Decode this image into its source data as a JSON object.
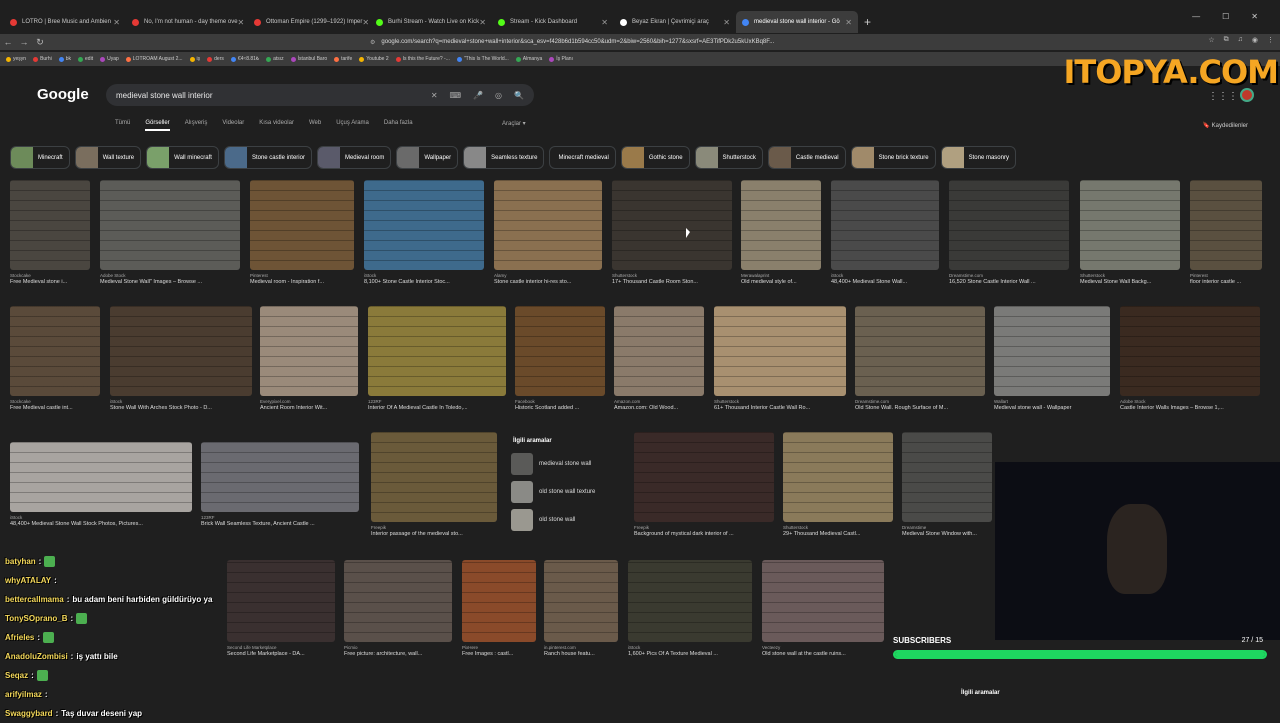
{
  "tabs": [
    {
      "label": "LOTRO | Bree Music and Ambien",
      "color": "#e53935"
    },
    {
      "label": "No, I'm not human - day theme ove",
      "color": "#e53935"
    },
    {
      "label": "Ottoman Empire (1299–1922) Imper",
      "color": "#e53935"
    },
    {
      "label": "Burhi Stream - Watch Live on Kick",
      "color": "#53fc18"
    },
    {
      "label": "Stream - Kick Dashboard",
      "color": "#53fc18"
    },
    {
      "label": "Beyaz Ekran | Çevrimiçi araç",
      "color": "#ffffff"
    },
    {
      "label": "medieval stone wall interior - Gö",
      "color": "#4285f4",
      "active": true
    }
  ],
  "url": "google.com/search?q=medieval+stone+wall+interior&sca_esv=f428b6d1b594cc50&udm=2&biw=2560&bih=1277&sxsrf=AE3TifPDk2u5kUxKBq8F...",
  "bookmarks": [
    "yeşyn",
    "Burhi",
    "bk",
    "edit",
    "Uyap",
    "LOTROAM August 2...",
    "iş",
    "ders",
    "€4≈8.81₺",
    "atsız",
    "İstanbul Baro",
    "tarife",
    "Youtube 2",
    "Is this the Future? -...",
    "\"This Is The World...",
    "Almanya",
    "İş Planı"
  ],
  "watermark": "ITOPYA.COM",
  "google_logo": "Google",
  "search_query": "medieval stone wall interior",
  "menu_tabs": [
    "Tümü",
    "Görseller",
    "Alışveriş",
    "Videolar",
    "Kısa videolar",
    "Web",
    "Uçuş Arama",
    "Daha fazla"
  ],
  "active_menu": "Görseller",
  "tools_label": "Araçlar",
  "saved_label": "Kaydedilenler",
  "chips": [
    {
      "label": "Minecraft",
      "color": "#6d8b5a"
    },
    {
      "label": "Wall texture",
      "color": "#7a6e5e"
    },
    {
      "label": "Wall minecraft",
      "color": "#7aa06a"
    },
    {
      "label": "Stone castle interior",
      "color": "#4b6a8a"
    },
    {
      "label": "Medieval room",
      "color": "#5a5a6a"
    },
    {
      "label": "Wallpaper",
      "color": "#6a6a6a"
    },
    {
      "label": "Seamless texture",
      "color": "#888"
    },
    {
      "label": "Minecraft medieval",
      "color": null
    },
    {
      "label": "Gothic stone",
      "color": "#9a7a4a"
    },
    {
      "label": "Shutterstock",
      "color": "#8a8a7a"
    },
    {
      "label": "Castle medieval",
      "color": "#6a5a4a"
    },
    {
      "label": "Stone brick texture",
      "color": "#a08a6a"
    },
    {
      "label": "Stone masonry",
      "color": "#b0a080"
    }
  ],
  "images": [
    {
      "src": "Stockcake",
      "cap": "Free Medieval stone i...",
      "color": "#4a4640"
    },
    {
      "src": "Adobe Stock",
      "cap": "Medieval Stone Wall\" Images – Browse ...",
      "color": "#5c5c58"
    },
    {
      "src": "Pinterest",
      "cap": "Medieval room - Inspiration f...",
      "color": "#6e5436"
    },
    {
      "src": "iStock",
      "cap": "8,100+ Stone Castle Interior Stoc...",
      "color": "#3e6a8c"
    },
    {
      "src": "Alamy",
      "cap": "Stone castle interior hi-res sto...",
      "color": "#8a7050"
    },
    {
      "src": "Shutterstock",
      "cap": "17+ Thousand Castle Room Ston...",
      "color": "#3a3530"
    },
    {
      "src": "Merawalaprint",
      "cap": "Old medieval style of...",
      "color": "#8a806c"
    },
    {
      "src": "iStock",
      "cap": "48,400+ Medieval Stone Wall...",
      "color": "#4a4a4a"
    },
    {
      "src": "Dreamstime.com",
      "cap": "16,520 Stone Castle Interior Wall ...",
      "color": "#3a3a38"
    },
    {
      "src": "Shutterstock",
      "cap": "Medieval Stone Wall Backg...",
      "color": "#76786e"
    },
    {
      "src": "Pinterest",
      "cap": "floor interior castle ...",
      "color": "#5a5040"
    },
    {
      "src": "Stockcake",
      "cap": "Free Medieval castle int...",
      "color": "#5a4a3a"
    },
    {
      "src": "iStock",
      "cap": "Stone Wall With Arches Stock Photo - D...",
      "color": "#4a3c30"
    },
    {
      "src": "Everypixel.com",
      "cap": "Ancient Room Interior Wit...",
      "color": "#9a8a7a"
    },
    {
      "src": "123RF",
      "cap": "Interior Of A Medieval Castle In Toledo,...",
      "color": "#8a7a3a"
    },
    {
      "src": "Facebook",
      "cap": "Historic Scotland added ...",
      "color": "#6a4a2a"
    },
    {
      "src": "Amazon.com",
      "cap": "Amazon.com: Old Wood...",
      "color": "#8a7a6a"
    },
    {
      "src": "Shutterstock",
      "cap": "61+ Thousand Interior Castle Wall Ro...",
      "color": "#a89070"
    },
    {
      "src": "Dreamstime.com",
      "cap": "Old Stone Wall. Rough Surface of M...",
      "color": "#6a6050"
    },
    {
      "src": "Wallart",
      "cap": "Medieval stone wall - Wallpaper",
      "color": "#7a7a78"
    },
    {
      "src": "Adobe Stock",
      "cap": "Castle Interior Walls Images – Browse 1,...",
      "color": "#3a2a20"
    },
    {
      "src": "iStock",
      "cap": "48,400+ Medieval Stone Wall Stock Photos, Pictures...",
      "color": "#a8a4a0"
    },
    {
      "src": "123RF",
      "cap": "Brick Wall Seamless Texture, Ancient Castle ...",
      "color": "#6a6a70"
    },
    {
      "src": "Freepik",
      "cap": "Interior passage of the medieval sto...",
      "color": "#6a5a3a"
    },
    {
      "src": "Freepik",
      "cap": "Background of mystical dark interior of ...",
      "color": "#3a2a28"
    },
    {
      "src": "Shutterstock",
      "cap": "29+ Thousand Medieval Castl...",
      "color": "#8a7a5a"
    },
    {
      "src": "Dreamstime",
      "cap": "Medieval Stone Window with...",
      "color": "#4a4a48"
    },
    {
      "src": "Second Life Marketplace",
      "cap": "Second Life Marketplace - DA...",
      "color": "#3a3030"
    },
    {
      "src": "Picmio",
      "cap": "Free picture: architecture, wall...",
      "color": "#5a504a"
    },
    {
      "src": "PixHere",
      "cap": "Free Images : castl...",
      "color": "#8a4a2a"
    },
    {
      "src": "in.pinterest.com",
      "cap": "Ranch house featu...",
      "color": "#6a5a4a"
    },
    {
      "src": "iStock",
      "cap": "1,600+ Pics Of A Texture Medieval ...",
      "color": "#3a3a30"
    },
    {
      "src": "Vecteezy",
      "cap": "Old stone wall at the castle ruins...",
      "color": "#6a5a5a"
    }
  ],
  "related": {
    "title": "İlgili aramalar",
    "items": [
      "medieval stone wall",
      "old stone wall texture",
      "old stone wall"
    ]
  },
  "related_bottom": "İlgili aramalar",
  "chat": [
    {
      "user": "batyhan",
      "text": "",
      "emote": true
    },
    {
      "user": "whyATALAY",
      "text": "",
      "emote": false
    },
    {
      "user": "bettercallmama",
      "text": "bu adam beni harbiden güldürüyo ya",
      "emote": false
    },
    {
      "user": "TonySOprano_B",
      "text": "",
      "emote": true
    },
    {
      "user": "Afrieles",
      "text": "",
      "emote": true
    },
    {
      "user": "AnadoluZombisi",
      "text": "iş yattı bile",
      "emote": false
    },
    {
      "user": "Seqaz",
      "text": "",
      "emote": true
    },
    {
      "user": "arifyilmaz",
      "text": "",
      "emote": false
    },
    {
      "user": "Swaggybard",
      "text": "Taş duvar deseni yap",
      "emote": false
    }
  ],
  "subscribers": {
    "label": "SUBSCRIBERS",
    "count": "27 / 15",
    "progress": 1.0
  }
}
